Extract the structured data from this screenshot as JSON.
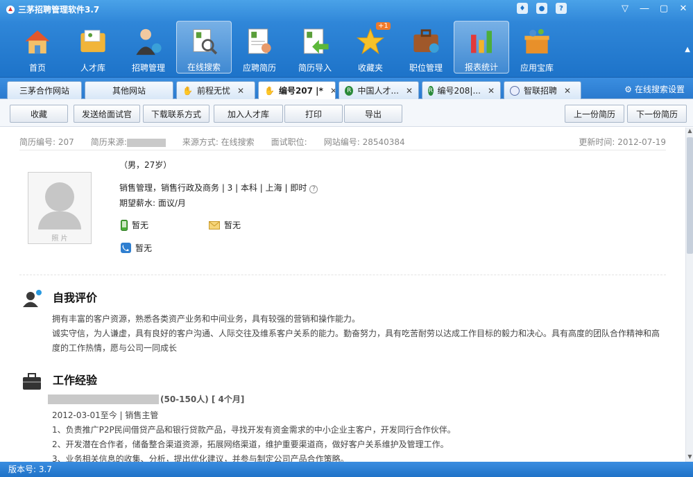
{
  "app": {
    "title": "三茅招聘管理软件3.7"
  },
  "toolbar": [
    {
      "label": "首页",
      "icon": "home-icon"
    },
    {
      "label": "人才库",
      "icon": "folder-icon"
    },
    {
      "label": "招聘管理",
      "icon": "recruiter-icon"
    },
    {
      "label": "在线搜索",
      "icon": "search-resume-icon"
    },
    {
      "label": "应聘简历",
      "icon": "resume-icon"
    },
    {
      "label": "简历导入",
      "icon": "import-icon"
    },
    {
      "label": "收藏夹",
      "icon": "star-icon",
      "badge": "+1"
    },
    {
      "label": "职位管理",
      "icon": "briefcase-icon"
    },
    {
      "label": "报表统计",
      "icon": "chart-icon"
    },
    {
      "label": "应用宝库",
      "icon": "gift-box-icon"
    }
  ],
  "tabs": [
    {
      "label": "三茅合作网站"
    },
    {
      "label": "其他网站"
    },
    {
      "label": "前程无忧",
      "icon": "hand-icon",
      "close": "✕"
    },
    {
      "label": "编号207 |*",
      "icon": "hand-icon",
      "close": "✕"
    },
    {
      "label": "中国人才...",
      "icon": "site-icon",
      "close": "✕"
    },
    {
      "label": "编号208|...",
      "icon": "site-icon",
      "close": "✕"
    },
    {
      "label": "智联招聘",
      "icon": "globe-icon",
      "close": "✕"
    }
  ],
  "tab_settings": "在线搜索设置",
  "actions": {
    "favorite": "收藏",
    "send": "发送给面试官",
    "download": "下载联系方式",
    "add": "加入人才库",
    "print": "打印",
    "export": "导出",
    "prev": "上一份简历",
    "next": "下一份简历"
  },
  "resume": {
    "meta": {
      "id": "简历编号: 207",
      "source_label": "简历来源:",
      "method": "来源方式: 在线搜索",
      "position": "面试职位:",
      "site_id": "网站编号: 28540384",
      "updated": "更新时间: 2012-07-19"
    },
    "photo_label": "照 片",
    "gender_age": "（男，27岁）",
    "summary": "销售管理，销售行政及商务 | 3 | 本科 | 上海 | 即时",
    "salary": "期望薪水: 面议/月",
    "mobile": "暂无",
    "email": "暂无",
    "phone": "暂无",
    "self_eval": {
      "title": "自我评价",
      "lines": [
        "拥有丰富的客户资源，熟悉各类资产业务和中间业务，具有较强的营销和操作能力。",
        "诚实守信，为人谦虚，具有良好的客户沟通、人际交往及维系客户关系的能力。勤奋努力，具有吃苦耐劳以达成工作目标的毅力和决心。具有高度的团队合作精神和高",
        "度的工作热情，愿与公司一同成长"
      ]
    },
    "work": {
      "title": "工作经验",
      "company_suffix": "(50-150人) [ 4个月]",
      "period": "2012-03-01至今 | 销售主管",
      "duties": [
        "1、负责推广P2P民间借贷产品和银行贷款产品，寻找开发有资金需求的中小企业主客户，开发同行合作伙伴。",
        "2、开发潜在合作者，储备整合渠道资源，拓展网络渠道，维护重要渠道商，做好客户关系维护及管理工作。",
        "3、业务相关信息的收集、分析，提出优化建议，并参与制定公司产品合作策略。"
      ]
    }
  },
  "status": {
    "version": "版本号: 3.7"
  }
}
